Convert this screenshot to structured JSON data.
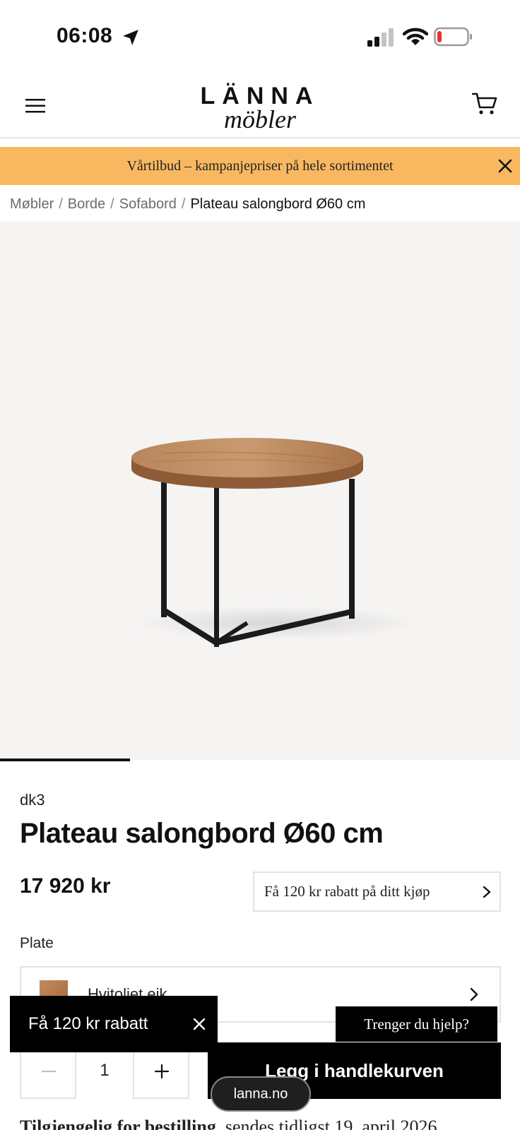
{
  "status_bar": {
    "time": "06:08"
  },
  "header": {
    "logo_line1": "LÄNNA",
    "logo_line2": "möbler"
  },
  "promo": {
    "text": "Vårtilbud – kampanjepriser på hele sortimentet"
  },
  "breadcrumb": {
    "items": [
      "Møbler",
      "Borde",
      "Sofabord"
    ],
    "separator": "/",
    "current": "Plateau salongbord Ø60 cm"
  },
  "gallery": {
    "active_index_fraction": 0.25
  },
  "product": {
    "brand": "dk3",
    "title": "Plateau salongbord Ø60 cm",
    "price": "17 920 kr",
    "discount_label": "Få 120 kr rabatt på ditt kjøp",
    "option_label": "Plate",
    "option_value": "Hvitoljet eik",
    "quantity": "1",
    "add_to_cart": "Legg i handlekurven",
    "availability_bold": "Tilgjengelig for bestilling",
    "availability_rest": ", sendes tidligst 19. april 2026"
  },
  "overlays": {
    "toast_text": "Få 120 kr rabatt",
    "help_button": "Trenger du hjelp?",
    "url": "lanna.no"
  },
  "colors": {
    "promo_bg": "#f9b860",
    "image_bg": "#f5f4f3",
    "primary": "#000000"
  },
  "icons": [
    "location-arrow-icon",
    "signal-icon",
    "wifi-icon",
    "battery-low-icon",
    "hamburger-menu-icon",
    "cart-icon",
    "close-icon",
    "chevron-right-icon",
    "minus-icon",
    "plus-icon"
  ]
}
